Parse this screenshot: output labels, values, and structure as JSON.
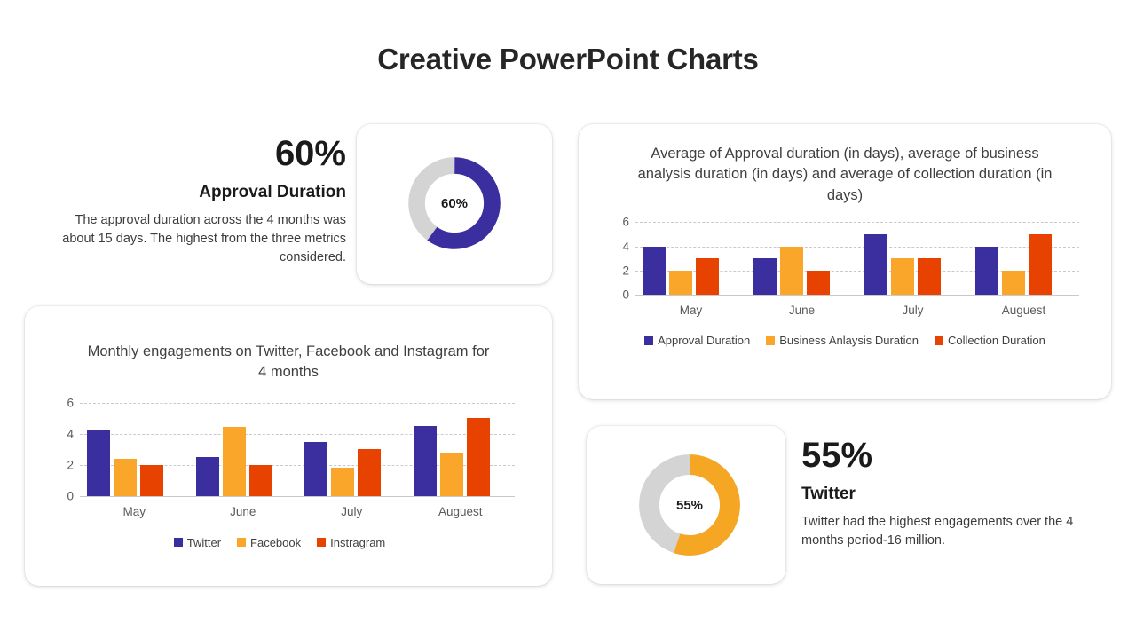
{
  "title": "Creative PowerPoint Charts",
  "colors": {
    "series_blue": "#3b2fa0",
    "series_orange": "#f9a62a",
    "series_red": "#e84200",
    "donut_track": "#d4d4d4",
    "title_dark": "#262626"
  },
  "kpi_approval": {
    "value": "60%",
    "label": "Approval Duration",
    "description": "The approval duration across the 4 months was about 15 days. The highest from the three metrics considered.",
    "donut_center": "60%",
    "donut_percent": 60,
    "donut_color": "#3b2fa0"
  },
  "kpi_twitter": {
    "value": "55%",
    "label": "Twitter",
    "description": "Twitter had the highest engagements over the 4 months period-16 million.",
    "donut_center": "55%",
    "donut_percent": 55,
    "donut_color": "#f5a623"
  },
  "chart_data": [
    {
      "id": "duration_chart",
      "type": "bar",
      "title": "Average of Approval duration (in days), average of business analysis duration (in days) and average of collection duration (in days)",
      "categories": [
        "May",
        "June",
        "July",
        "Auguest"
      ],
      "series": [
        {
          "name": "Approval Duration",
          "color": "#3b2fa0",
          "values": [
            4,
            3,
            5,
            4
          ]
        },
        {
          "name": "Business Anlaysis Duration",
          "color": "#f9a62a",
          "values": [
            2,
            4,
            3,
            2
          ]
        },
        {
          "name": "Collection Duration",
          "color": "#e84200",
          "values": [
            3,
            2,
            3,
            5
          ]
        }
      ],
      "yticks": [
        6,
        4,
        2,
        0
      ],
      "ylim": [
        0,
        6
      ],
      "xlabel": "",
      "ylabel": "",
      "grid": true,
      "legend_position": "bottom"
    },
    {
      "id": "engagement_chart",
      "type": "bar",
      "title": "Monthly engagements on Twitter, Facebook and Instagram for 4 months",
      "categories": [
        "May",
        "June",
        "July",
        "Auguest"
      ],
      "series": [
        {
          "name": "Twitter",
          "color": "#3b2fa0",
          "values": [
            4.3,
            2.5,
            3.5,
            4.5
          ]
        },
        {
          "name": "Facebook",
          "color": "#f9a62a",
          "values": [
            2.4,
            4.45,
            1.8,
            2.8
          ]
        },
        {
          "name": "Instragram",
          "color": "#e84200",
          "values": [
            2.0,
            2.0,
            3.0,
            5.0
          ]
        }
      ],
      "yticks": [
        6,
        4,
        2,
        0
      ],
      "ylim": [
        0,
        6
      ],
      "xlabel": "",
      "ylabel": "",
      "grid": true,
      "legend_position": "bottom"
    }
  ]
}
